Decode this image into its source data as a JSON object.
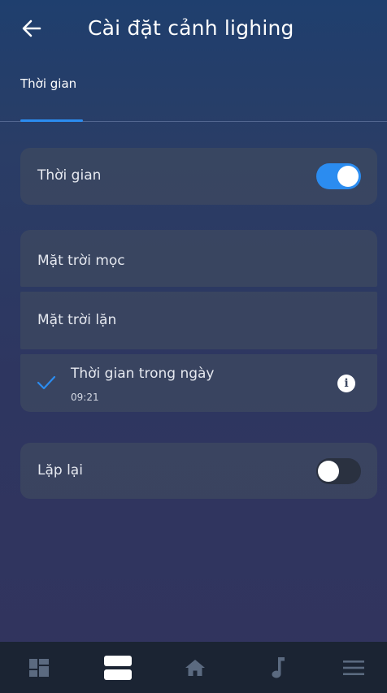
{
  "header": {
    "title": "Cài đặt cảnh lighing",
    "back_icon": "arrow-left-icon"
  },
  "tabs": [
    {
      "label": "Thời gian",
      "active": true
    }
  ],
  "time_card": {
    "label": "Thời gian",
    "toggle_on": true
  },
  "options": [
    {
      "label": "Mặt trời mọc"
    },
    {
      "label": "Mặt trời lặn"
    },
    {
      "label": "Thời gian trong ngày",
      "sub": "09:21",
      "selected": true,
      "icon": "info-icon"
    }
  ],
  "repeat_card": {
    "label": "Lặp lại",
    "toggle_on": false
  },
  "bottom_nav": [
    {
      "icon": "dashboard-grid-icon",
      "active": false
    },
    {
      "icon": "scenes-stack-icon",
      "active": true
    },
    {
      "icon": "home-icon",
      "active": false
    },
    {
      "icon": "music-note-icon",
      "active": false
    },
    {
      "icon": "menu-icon",
      "active": false
    }
  ],
  "colors": {
    "accent": "#2b8cf0",
    "card": "#3e4a60",
    "nav_bg": "#1b2433",
    "nav_icon": "#5b6a80"
  }
}
